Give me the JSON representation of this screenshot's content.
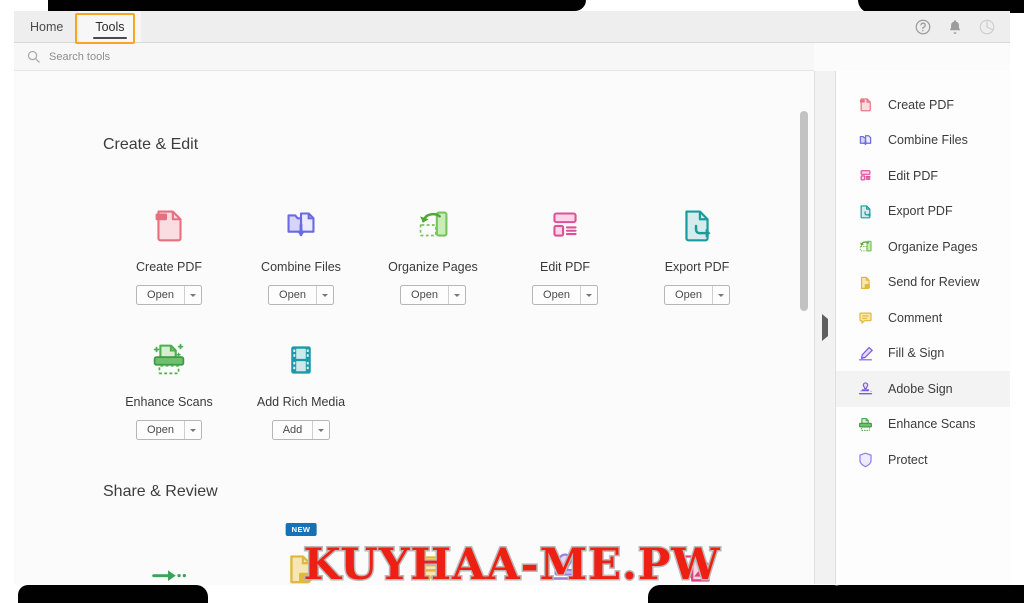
{
  "window": {
    "tabs": [
      {
        "label": "Home",
        "active": false
      },
      {
        "label": "Tools",
        "active": true
      }
    ],
    "top_right_icons": [
      {
        "name": "help-icon",
        "label": "Help"
      },
      {
        "name": "bell-icon",
        "label": "Notifications"
      },
      {
        "name": "avatar-icon",
        "label": "Account"
      }
    ],
    "annotation_color": "#f5a623"
  },
  "search": {
    "placeholder": "Search tools",
    "icon": "search-icon"
  },
  "main": {
    "sections": [
      {
        "title": "Create & Edit",
        "rows": [
          [
            {
              "label": "Create PDF",
              "icon": "create-pdf-icon",
              "color": "#e8707e",
              "button": "Open",
              "has_caret": true,
              "badge": null
            },
            {
              "label": "Combine Files",
              "icon": "combine-files-icon",
              "color": "#6b6be0",
              "button": "Open",
              "has_caret": true,
              "badge": null
            },
            {
              "label": "Organize Pages",
              "icon": "organize-pages-icon",
              "color": "#7ac45f",
              "button": "Open",
              "has_caret": true,
              "badge": null
            },
            {
              "label": "Edit PDF",
              "icon": "edit-pdf-icon",
              "color": "#e0509a",
              "button": "Open",
              "has_caret": true,
              "badge": null
            },
            {
              "label": "Export PDF",
              "icon": "export-pdf-icon",
              "color": "#189b9b",
              "button": "Open",
              "has_caret": true,
              "badge": null
            }
          ],
          [
            {
              "label": "Enhance Scans",
              "icon": "enhance-scans-icon",
              "color": "#4caf50",
              "button": "Open",
              "has_caret": true,
              "badge": null
            },
            {
              "label": "Add Rich Media",
              "icon": "add-rich-media-icon",
              "color": "#1b9aaa",
              "button": "Add",
              "has_caret": true,
              "badge": null
            }
          ]
        ]
      },
      {
        "title": "Share & Review",
        "rows": [
          [
            {
              "label": "",
              "icon": "send-arrow-icon",
              "color": "#3aa35a",
              "button": null,
              "has_caret": false,
              "badge": null
            },
            {
              "label": "",
              "icon": "send-for-review-icon",
              "color": "#e0b93c",
              "button": null,
              "has_caret": false,
              "badge": "NEW"
            },
            {
              "label": "",
              "icon": "comment-icon",
              "color": "#e0b93c",
              "button": null,
              "has_caret": false,
              "badge": null
            },
            {
              "label": "",
              "icon": "stamp-icon",
              "color": "#9a7ce0",
              "button": null,
              "has_caret": false,
              "badge": null
            },
            {
              "label": "",
              "icon": "compare-files-icon",
              "color": "#e0407e",
              "button": null,
              "has_caret": false,
              "badge": null
            }
          ]
        ]
      }
    ]
  },
  "sidebar": {
    "items": [
      {
        "label": "Create PDF",
        "icon": "create-pdf-icon",
        "color": "#e8707e",
        "hover": false
      },
      {
        "label": "Combine Files",
        "icon": "combine-files-icon",
        "color": "#6b6be0",
        "hover": false
      },
      {
        "label": "Edit PDF",
        "icon": "edit-pdf-icon",
        "color": "#e0509a",
        "hover": false
      },
      {
        "label": "Export PDF",
        "icon": "export-pdf-icon",
        "color": "#189b9b",
        "hover": false
      },
      {
        "label": "Organize Pages",
        "icon": "organize-pages-icon",
        "color": "#7ac45f",
        "hover": false
      },
      {
        "label": "Send for Review",
        "icon": "send-for-review-icon",
        "color": "#e0b93c",
        "hover": false
      },
      {
        "label": "Comment",
        "icon": "comment-icon",
        "color": "#e0b93c",
        "hover": false
      },
      {
        "label": "Fill & Sign",
        "icon": "fill-sign-icon",
        "color": "#7b5ce0",
        "hover": false
      },
      {
        "label": "Adobe Sign",
        "icon": "adobe-sign-icon",
        "color": "#7b5ce0",
        "hover": true
      },
      {
        "label": "Enhance Scans",
        "icon": "enhance-scans-icon",
        "color": "#4caf50",
        "hover": false
      },
      {
        "label": "Protect",
        "icon": "protect-icon",
        "color": "#8d86e8",
        "hover": false
      }
    ],
    "collapse_icon": "chevron-right-icon"
  },
  "scrollbar": {
    "name": "main-scrollbar"
  },
  "watermark": {
    "text": "KUYHAA-ME.PW",
    "color": "#ee2014",
    "stroke": "#b9b9b9"
  }
}
